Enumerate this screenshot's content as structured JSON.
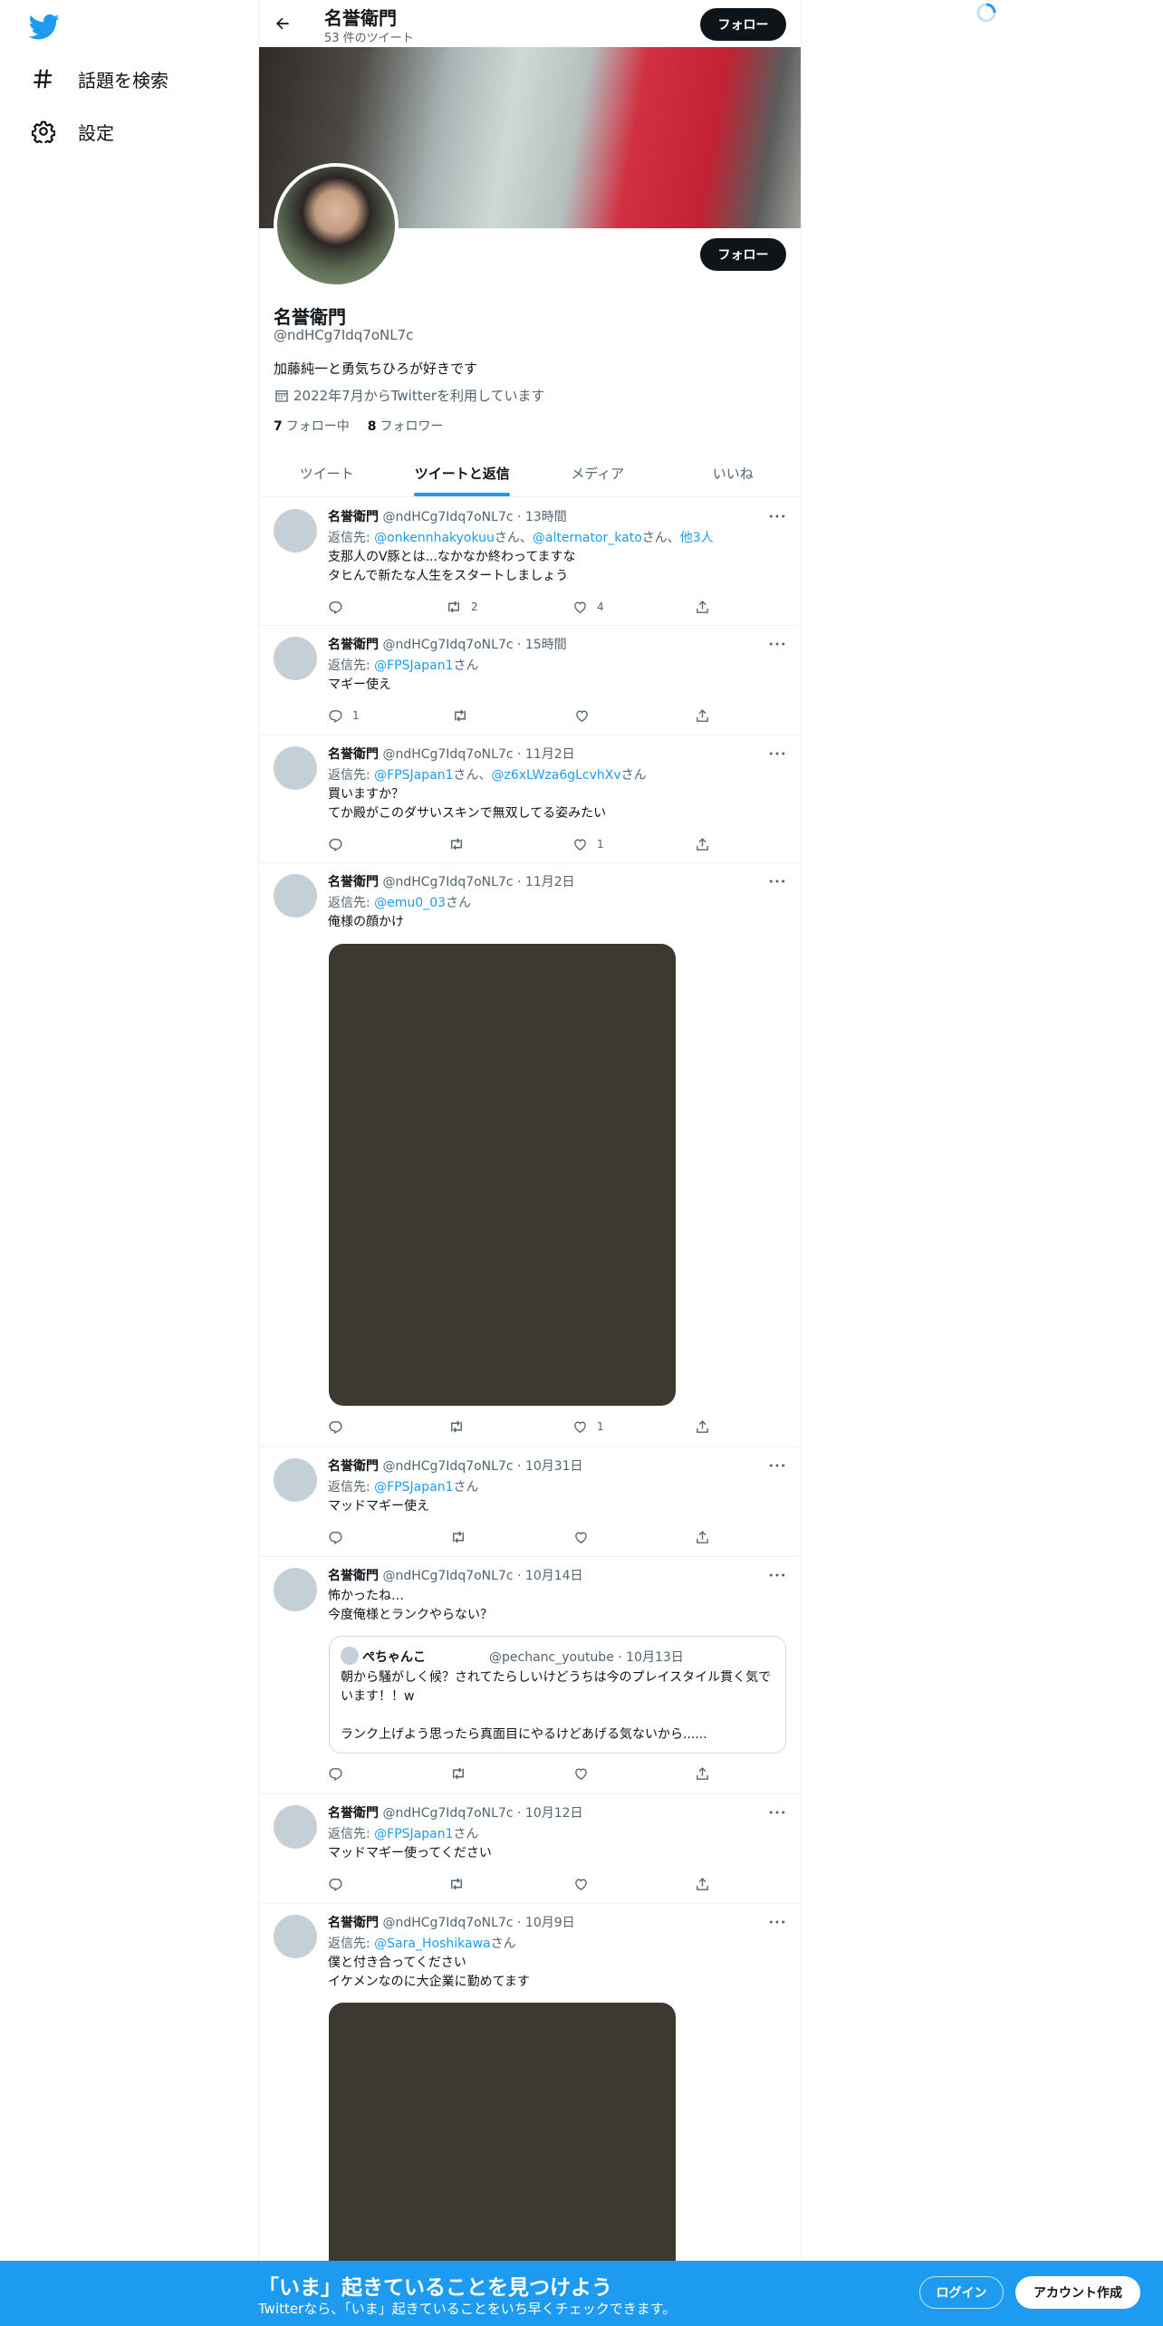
{
  "nav": {
    "explore_label": "話題を検索",
    "settings_label": "設定"
  },
  "topbar": {
    "name": "名誉衛門",
    "tweet_count": "53 件のツイート",
    "follow_label": "フォロー"
  },
  "profile": {
    "name": "名誉衛門",
    "handle": "@ndHCg7Idq7oNL7c",
    "bio": "加藤純一と勇気ちひろが好きです",
    "joined": "2022年7月からTwitterを利用しています",
    "following_count": "7",
    "following_label": "フォロー中",
    "followers_count": "8",
    "followers_label": "フォロワー",
    "follow_label": "フォロー"
  },
  "tabs": [
    "ツイート",
    "ツイートと返信",
    "メディア",
    "いいね"
  ],
  "active_tab": "ツイートと返信",
  "reply_prefix": "返信先: ",
  "tweets": [
    {
      "name": "名誉衛門",
      "meta": " @ndHCg7Idq7oNL7c · 13時間",
      "mentions": [
        "@onkennhakyokuu",
        "@alternator_kato"
      ],
      "mention_suffixes": [
        "さん、",
        "さん、"
      ],
      "others": "他3人",
      "text": "支那人のV豚とは...なかなか終わってますな\nタヒんで新たな人生をスタートしましょう",
      "reply_count": "",
      "retweet_count": "2",
      "like_count": "4"
    },
    {
      "name": "名誉衛門",
      "meta": " @ndHCg7Idq7oNL7c · 15時間",
      "mentions": [
        "@FPSJapan1"
      ],
      "mention_suffixes": [
        "さん"
      ],
      "text": "マギー使え",
      "reply_count": "1",
      "retweet_count": "",
      "like_count": ""
    },
    {
      "name": "名誉衛門",
      "meta": " @ndHCg7Idq7oNL7c · 11月2日",
      "mentions": [
        "@FPSJapan1",
        "@z6xLWza6gLcvhXv"
      ],
      "mention_suffixes": [
        "さん、",
        "さん"
      ],
      "text": "買いますか？\nてか殿がこのダサいスキンで無双してる姿みたい",
      "reply_count": "",
      "retweet_count": "",
      "like_count": "1"
    },
    {
      "name": "名誉衛門",
      "meta": " @ndHCg7Idq7oNL7c · 11月2日",
      "mentions": [
        "@emu0_03"
      ],
      "mention_suffixes": [
        "さん"
      ],
      "text": "俺様の顔かけ",
      "has_media": true,
      "reply_count": "",
      "retweet_count": "",
      "like_count": "1"
    },
    {
      "name": "名誉衛門",
      "meta": " @ndHCg7Idq7oNL7c · 10月31日",
      "mentions": [
        "@FPSJapan1"
      ],
      "mention_suffixes": [
        "さん"
      ],
      "text": "マッドマギー使え",
      "reply_count": "",
      "retweet_count": "",
      "like_count": ""
    },
    {
      "name": "名誉衛門",
      "meta": " @ndHCg7Idq7oNL7c · 10月14日",
      "text": "怖かったね…\n今度俺様とランクやらない？",
      "quote": {
        "name": "ぺちゃんこ",
        "meta": "@pechanc_youtube · 10月13日",
        "text": "朝から騒がしく候？されてたらしいけどうちは今のプレイスタイル貫く気でいます！！w\n\nランク上げよう思ったら真面目にやるけどあげる気ないから......"
      },
      "reply_count": "",
      "retweet_count": "",
      "like_count": ""
    },
    {
      "name": "名誉衛門",
      "meta": " @ndHCg7Idq7oNL7c · 10月12日",
      "mentions": [
        "@FPSJapan1"
      ],
      "mention_suffixes": [
        "さん"
      ],
      "text": "マッドマギー使ってください",
      "reply_count": "",
      "retweet_count": "",
      "like_count": ""
    },
    {
      "name": "名誉衛門",
      "meta": " @ndHCg7Idq7oNL7c · 10月9日",
      "mentions": [
        "@Sara_Hoshikawa"
      ],
      "mention_suffixes": [
        "さん"
      ],
      "text": "僕と付き合ってください\nイケメンなのに大企業に勤めてます",
      "has_media": true
    }
  ],
  "bottom_bar": {
    "title": "「いま」起きていることを見つけよう",
    "subtitle": "Twitterなら、「いま」起きていることをいち早くチェックできます。",
    "login_label": "ログイン",
    "signup_label": "アカウント作成"
  },
  "colors": {
    "accent": "#1d9bf0",
    "text": "#0f1419",
    "secondary_text": "#536471",
    "border": "#eff3f4"
  }
}
